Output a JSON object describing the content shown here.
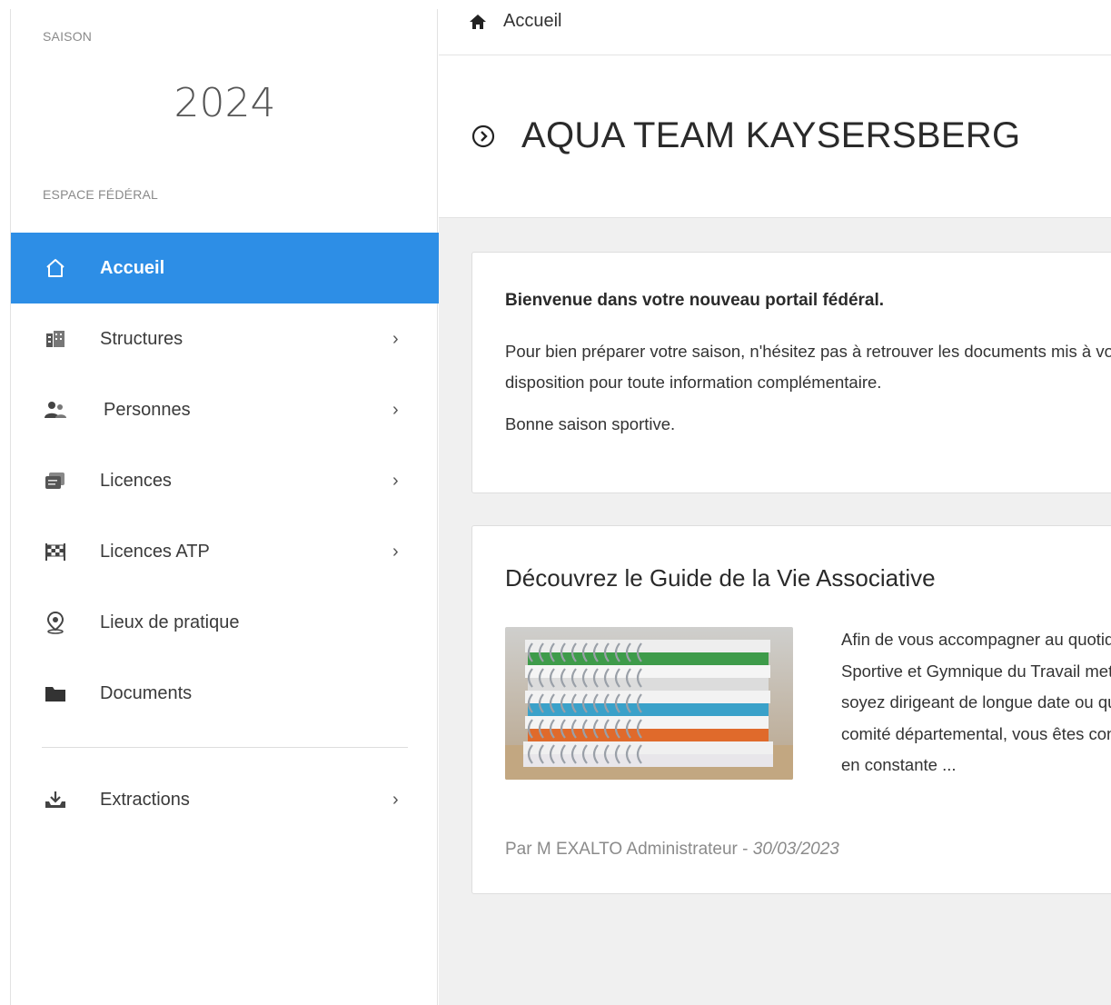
{
  "sidebar": {
    "season_label": "SAISON",
    "season_year": "2024",
    "section_label": "ESPACE FÉDÉRAL",
    "items": [
      {
        "label": "Accueil",
        "icon": "home-icon",
        "active": true,
        "has_chevron": false
      },
      {
        "label": "Structures",
        "icon": "building-icon",
        "active": false,
        "has_chevron": true
      },
      {
        "label": "Personnes",
        "icon": "people-icon",
        "active": false,
        "has_chevron": true
      },
      {
        "label": "Licences",
        "icon": "cards-icon",
        "active": false,
        "has_chevron": true
      },
      {
        "label": "Licences ATP",
        "icon": "checkered-flag-icon",
        "active": false,
        "has_chevron": true
      },
      {
        "label": "Lieux de pratique",
        "icon": "location-pin-icon",
        "active": false,
        "has_chevron": false
      },
      {
        "label": "Documents",
        "icon": "folder-icon",
        "active": false,
        "has_chevron": false
      }
    ],
    "extra_items": [
      {
        "label": "Extractions",
        "icon": "download-tray-icon",
        "active": false,
        "has_chevron": true
      }
    ],
    "chevron": "›"
  },
  "breadcrumb": {
    "label": "Accueil"
  },
  "page": {
    "title": "AQUA TEAM KAYSERSBERG"
  },
  "welcome": {
    "title": "Bienvenue dans votre nouveau portail fédéral.",
    "line1": "Pour bien préparer votre saison, n'hésitez pas à retrouver les documents mis à votre",
    "line2": "disposition pour toute information complémentaire.",
    "line3": "Bonne saison sportive."
  },
  "guide": {
    "title": "Découvrez le Guide de la Vie Associative",
    "excerpt_lines": [
      "Afin de vous accompagner au quotidien, la Fédération",
      "Sportive et Gymnique du Travail met à votre disposition",
      "soyez dirigeant de longue date ou que vous rejoigniez",
      "comité départemental, vous êtes confrontés à une réglementation",
      "en constante ..."
    ],
    "author": "Par M EXALTO Administrateur - ",
    "date": "30/03/2023"
  },
  "colors": {
    "accent": "#2d8ee6",
    "background": "#f0f0f0"
  }
}
